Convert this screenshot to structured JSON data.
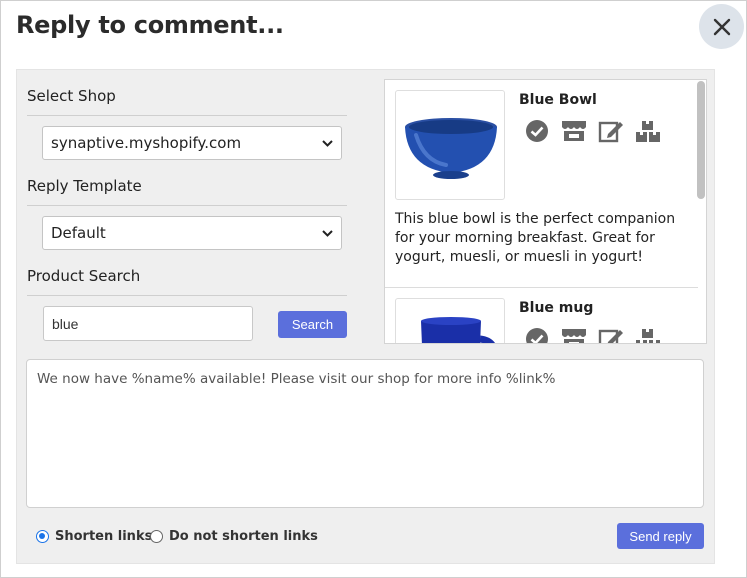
{
  "dialog": {
    "title": "Reply to comment...",
    "close_icon": "close-icon"
  },
  "form": {
    "shop_label": "Select Shop",
    "shop_value": "synaptive.myshopify.com",
    "template_label": "Reply Template",
    "template_value": "Default",
    "search_label": "Product Search",
    "search_value": "blue",
    "search_button": "Search"
  },
  "products": [
    {
      "name": "Blue Bowl",
      "description": "This blue bowl is the perfect companion for your morning breakfast. Great for yogurt, muesli, or muesli in yogurt!",
      "icons": [
        "check-circle-icon",
        "store-icon",
        "edit-icon",
        "boxes-icon"
      ]
    },
    {
      "name": "Blue mug",
      "description": "",
      "icons": [
        "check-circle-icon",
        "store-icon",
        "edit-icon",
        "boxes-icon"
      ]
    }
  ],
  "reply": {
    "text": "We now have %name% available! Please visit our shop for more info %link%"
  },
  "options": {
    "shorten": "Shorten links",
    "no_shorten": "Do not shorten links",
    "selected": "shorten"
  },
  "send_button": "Send reply",
  "colors": {
    "accent": "#5b6fdc",
    "radio": "#1a73e8",
    "panel": "#efefef"
  }
}
